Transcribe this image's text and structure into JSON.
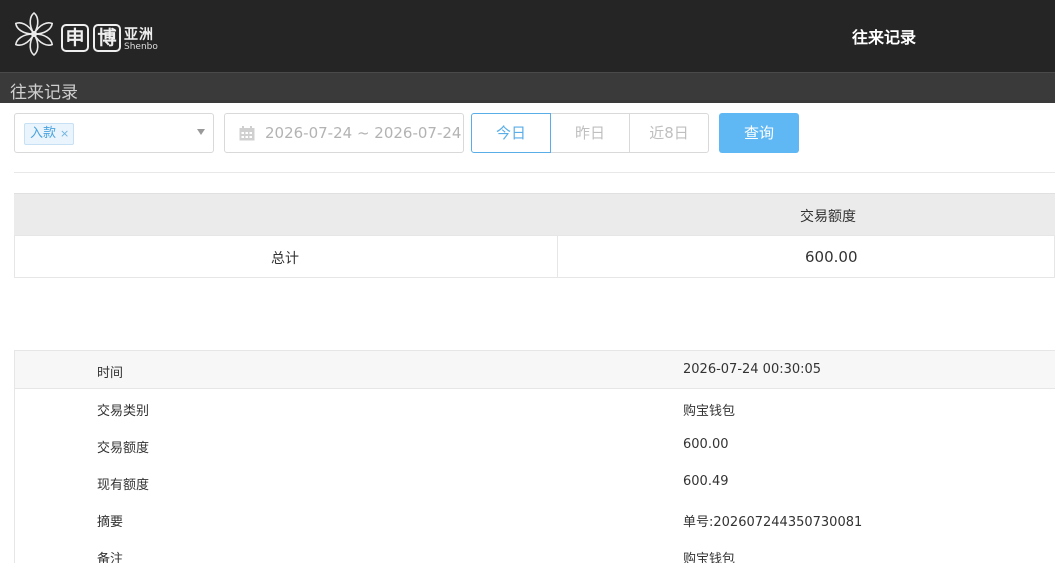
{
  "header": {
    "logo_cn_1": "申",
    "logo_cn_2": "博",
    "logo_cn_3": "亚洲",
    "logo_en": "Shenbo",
    "title": "往来记录"
  },
  "subbar": {
    "title": "往来记录"
  },
  "filters": {
    "type_tag": "入款",
    "type_tag_remove": "×",
    "date_range": "2026-07-24 ~ 2026-07-24",
    "quick_ranges": [
      "今日",
      "昨日",
      "近8日"
    ],
    "query_label": "查询"
  },
  "summary": {
    "col_header": "交易额度",
    "row_label": "总计",
    "row_value": "600.00"
  },
  "detail": [
    {
      "key": "时间",
      "value": "2026-07-24 00:30:05"
    },
    {
      "key": "交易类别",
      "value": "购宝钱包"
    },
    {
      "key": "交易额度",
      "value": "600.00"
    },
    {
      "key": "现有额度",
      "value": "600.49"
    },
    {
      "key": "摘要",
      "value": "单号:202607244350730081"
    },
    {
      "key": "备注",
      "value": "购宝钱包"
    }
  ],
  "colors": {
    "accent": "#5fb8f4",
    "header_bg": "#252525",
    "subbar_bg": "#3a3a3a"
  }
}
